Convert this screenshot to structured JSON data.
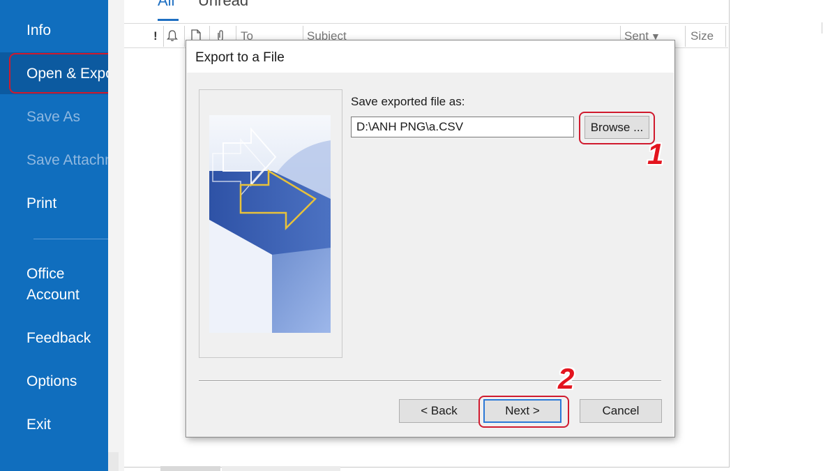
{
  "sidebar": {
    "items": [
      {
        "label": "Info",
        "enabled": true
      },
      {
        "label": "Open & Export",
        "enabled": true,
        "selected": true
      },
      {
        "label": "Save As",
        "enabled": false
      },
      {
        "label": "Save Attachments",
        "enabled": false
      },
      {
        "label": "Print",
        "enabled": true
      },
      {
        "label_line1": "Office",
        "label_line2": "Account",
        "enabled": true
      },
      {
        "label": "Feedback",
        "enabled": true
      },
      {
        "label": "Options",
        "enabled": true
      },
      {
        "label": "Exit",
        "enabled": true
      }
    ]
  },
  "mail_list": {
    "tabs": [
      "All",
      "Unread"
    ],
    "columns": {
      "importance": "!",
      "to": "To",
      "subject": "Subject",
      "sent": "Sent",
      "size": "Size"
    },
    "sort_indicator": "▼",
    "icons": [
      "reminder-bell-icon",
      "document-icon",
      "attachment-icon"
    ]
  },
  "dialog": {
    "title": "Export to a File",
    "save_label": "Save exported file as:",
    "path_value": "D:\\ANH PNG\\a.CSV",
    "buttons": {
      "browse": "Browse ...",
      "back": "< Back",
      "next": "Next >",
      "cancel": "Cancel"
    }
  },
  "annotations": {
    "step1": "1",
    "step2": "2",
    "highlight_color": "#d01a2e"
  },
  "colors": {
    "sidebar_bg": "#106ebe",
    "accent": "#1e6fc2"
  }
}
